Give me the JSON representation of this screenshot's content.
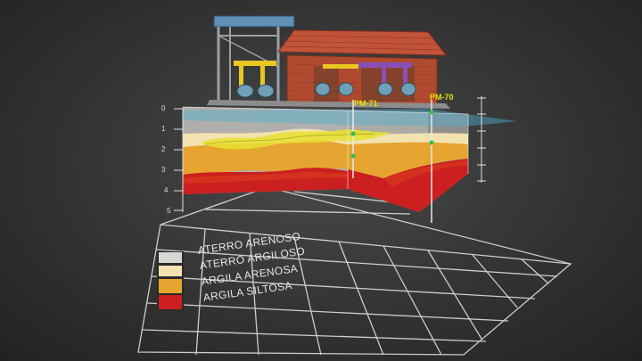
{
  "scene": {
    "background": "#3a3a3a",
    "colors": {
      "aterro_arenoso": "#d6d6d0",
      "aterro_argiloso": "#f5e6b4",
      "argila_arenosa": "#e6a430",
      "argila_siltosa": "#cc1f1f",
      "water": "#4fb0d0",
      "contaminant": "#e8e030"
    }
  },
  "wells": [
    {
      "label": "PM-71"
    },
    {
      "label": "PM-70"
    }
  ],
  "depth_scale": {
    "ticks": [
      "0",
      "1",
      "2",
      "3",
      "4",
      "5"
    ]
  },
  "legend": {
    "items": [
      {
        "label": "ATERRO ARENOSO",
        "color": "#d8d8d2"
      },
      {
        "label": "ATERRO ARGILOSO",
        "color": "#f2e2b0"
      },
      {
        "label": "ARGILA ARENOSA",
        "color": "#e6a430"
      },
      {
        "label": "ARGILA SILTOSA",
        "color": "#cc1f1f"
      }
    ]
  }
}
